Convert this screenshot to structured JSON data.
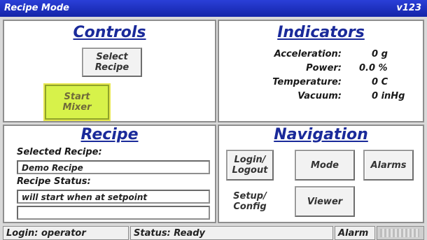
{
  "app": {
    "title": "Recipe Mode",
    "version": "v123"
  },
  "controls": {
    "heading": "Controls",
    "select_recipe_label": "Select\nRecipe",
    "start_mixer_label": "Start\nMixer"
  },
  "indicators": {
    "heading": "Indicators",
    "rows": [
      {
        "label": "Acceleration:",
        "value": "0 g"
      },
      {
        "label": "Power:",
        "value": "0.0 %"
      },
      {
        "label": "Temperature:",
        "value": "0 C"
      },
      {
        "label": "Vacuum:",
        "value": "0 inHg"
      }
    ]
  },
  "recipe": {
    "heading": "Recipe",
    "selected_label": "Selected Recipe:",
    "selected_value": "Demo Recipe",
    "status_label": "Recipe Status:",
    "status_value": "will start when at setpoint",
    "status_extra": ""
  },
  "navigation": {
    "heading": "Navigation",
    "login_logout": "Login/\nLogout",
    "mode": "Mode",
    "alarms": "Alarms",
    "setup_config": "Setup/\nConfig",
    "viewer": "Viewer"
  },
  "statusbar": {
    "login": "Login: operator",
    "status": "Status: Ready",
    "alarm": "Alarm"
  },
  "colors": {
    "titlebar": "#1e33c4",
    "heading": "#1a2a9a",
    "start_button": "#d7f24a"
  }
}
